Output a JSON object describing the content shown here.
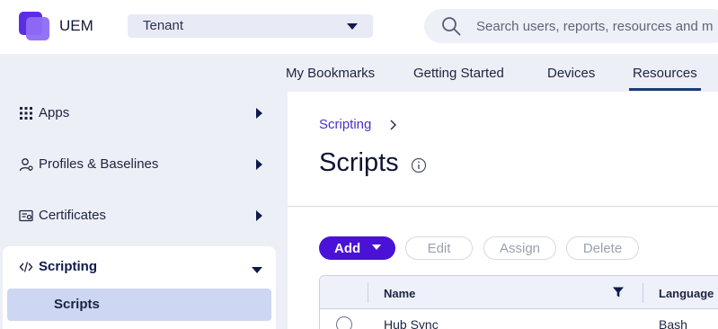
{
  "header": {
    "app_name": "UEM",
    "tenant_label": "Tenant",
    "search_placeholder": "Search users, reports, resources and m"
  },
  "top_nav": {
    "items": [
      {
        "label": "My Bookmarks"
      },
      {
        "label": "Getting Started"
      },
      {
        "label": "Devices"
      },
      {
        "label": "Resources",
        "active": true
      }
    ]
  },
  "sidebar": {
    "items": [
      {
        "label": "Apps",
        "icon": "grid-icon"
      },
      {
        "label": "Profiles & Baselines",
        "icon": "user-settings-icon"
      },
      {
        "label": "Certificates",
        "icon": "certificate-icon"
      },
      {
        "label": "Scripting",
        "icon": "code-icon",
        "expanded": true
      }
    ],
    "sub_items": [
      {
        "label": "Scripts",
        "selected": true
      }
    ]
  },
  "main": {
    "breadcrumb": [
      "Scripting"
    ],
    "title": "Scripts",
    "toolbar": {
      "add_label": "Add",
      "edit_label": "Edit",
      "assign_label": "Assign",
      "delete_label": "Delete"
    },
    "table": {
      "columns": [
        "Name",
        "Language"
      ],
      "rows": [
        {
          "name": "Hub Sync",
          "language": "Bash"
        }
      ]
    }
  },
  "colors": {
    "accent": "#4a12d6",
    "nav_active_underline": "#1b3b78",
    "sidebar_bg": "#edeff7",
    "selected_item_bg": "#cdd6f2"
  }
}
